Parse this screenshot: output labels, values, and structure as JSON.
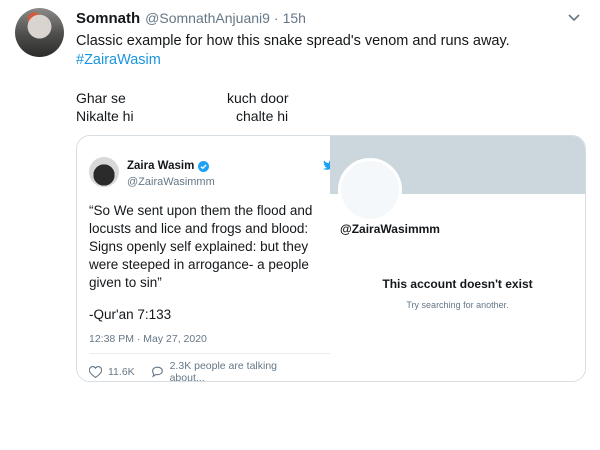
{
  "tweet": {
    "display_name": "Somnath",
    "handle": "@SomnathAnjuani9",
    "separator": "·",
    "time": "15h",
    "text": "Classic example for how this snake spread's venom and runs away.",
    "hashtag": "#ZairaWasim",
    "meme_left": {
      "line1": "Ghar se",
      "line2": "Nikalte hi"
    },
    "meme_right": {
      "line1": "kuch door",
      "line2": "chalte hi"
    }
  },
  "embedded_tweet": {
    "name": "Zaira Wasim",
    "handle": "@ZairaWasimmm",
    "body": "“So We sent upon them the flood and locusts and lice and frogs and blood: Signs openly self explained: but they were steeped in arrogance- a people given to sin”",
    "reference": "-Qur'an 7:133",
    "timestamp": "12:38 PM · May 27, 2020",
    "likes": "11.6K",
    "talking": "2.3K people are talking about..."
  },
  "embedded_profile": {
    "handle": "@ZairaWasimmm",
    "status": "This account doesn't exist",
    "hint": "Try searching for another."
  },
  "colors": {
    "link": "#1b95e0",
    "secondary_text": "#657786",
    "banner": "#ccd6dd",
    "verified": "#1da1f2"
  }
}
